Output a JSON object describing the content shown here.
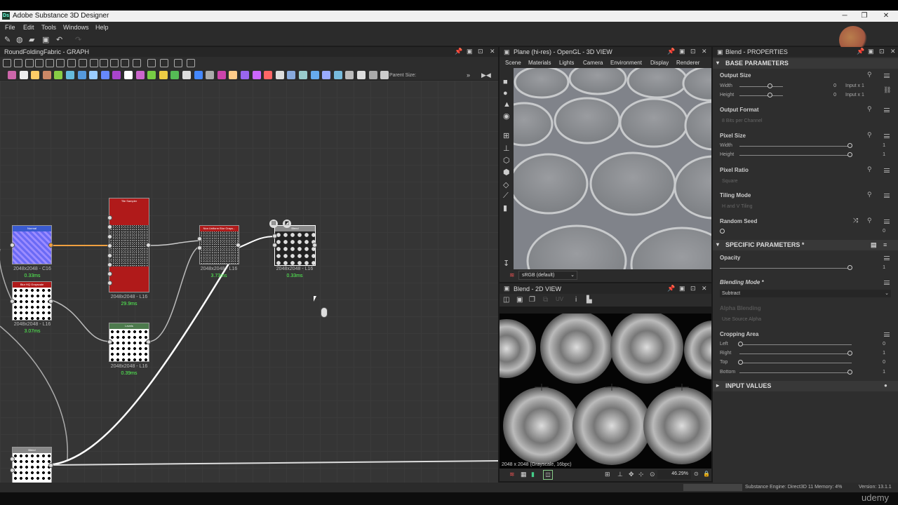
{
  "window": {
    "title": "Adobe Substance 3D Designer",
    "app_icon": "Ds"
  },
  "menu": [
    "File",
    "Edit",
    "Tools",
    "Windows",
    "Help"
  ],
  "graph": {
    "title": "RoundFoldingFabric - GRAPH",
    "parent_size_label": "Parent Size:",
    "nodes": [
      {
        "name": "Normal",
        "res": "2048x2048 - C16",
        "time": "0.33ms"
      },
      {
        "name": "Tile Sampler",
        "res": "2048x2048 - L16",
        "time": "29.9ms"
      },
      {
        "name": "Non Uniform Blur Grays...",
        "res": "2048x2048 - L16",
        "time": "3.73ms"
      },
      {
        "name": "Blend",
        "res": "2048x2048 - L16",
        "time": "0.33ms"
      },
      {
        "name": "Blur HQ Grayscale",
        "res": "2048x2048 - L16",
        "time": "3.07ms"
      },
      {
        "name": "Levels",
        "res": "2048x2048 - L16",
        "time": "0.39ms"
      },
      {
        "name": "Blend",
        "res": "",
        "time": ""
      }
    ]
  },
  "view3d": {
    "title": "Plane (hi-res) - OpenGL - 3D VIEW",
    "menu": [
      "Scene",
      "Materials",
      "Lights",
      "Camera",
      "Environment",
      "Display",
      "Renderer"
    ],
    "colorspace": "sRGB (default)"
  },
  "view2d": {
    "title": "Blend - 2D VIEW",
    "info": "2048 x 2048 (Grayscale, 16bpc)",
    "zoom": "46.29%"
  },
  "properties": {
    "title": "Blend - PROPERTIES",
    "base_section": "BASE PARAMETERS",
    "output_size": {
      "label": "Output Size",
      "width_label": "Width",
      "height_label": "Height",
      "width_val": "0",
      "height_val": "0",
      "width_rel": "Input x 1",
      "height_rel": "Input x 1"
    },
    "output_format": {
      "label": "Output Format",
      "value": "8 Bits per Channel"
    },
    "pixel_size": {
      "label": "Pixel Size",
      "width_label": "Width",
      "height_label": "Height",
      "width_val": "1",
      "height_val": "1"
    },
    "pixel_ratio": {
      "label": "Pixel Ratio",
      "value": "Square"
    },
    "tiling_mode": {
      "label": "Tiling Mode",
      "value": "H and V Tiling"
    },
    "random_seed": {
      "label": "Random Seed",
      "value": "0"
    },
    "specific_section": "SPECIFIC PARAMETERS *",
    "opacity": {
      "label": "Opacity",
      "value": "1"
    },
    "blending_mode": {
      "label": "Blending Mode *",
      "value": "Subtract"
    },
    "alpha_blending": {
      "label": "Alpha Blending",
      "value": "Use Source Alpha"
    },
    "cropping_area": {
      "label": "Cropping Area",
      "left_label": "Left",
      "right_label": "Right",
      "top_label": "Top",
      "bottom_label": "Bottom",
      "left": "0",
      "right": "1",
      "top": "0",
      "bottom": "1"
    },
    "input_section": "INPUT VALUES"
  },
  "status": {
    "engine": "Substance Engine: Direct3D 11  Memory: 4%",
    "version": "Version: 13.1.1"
  },
  "watermark": "udemy"
}
